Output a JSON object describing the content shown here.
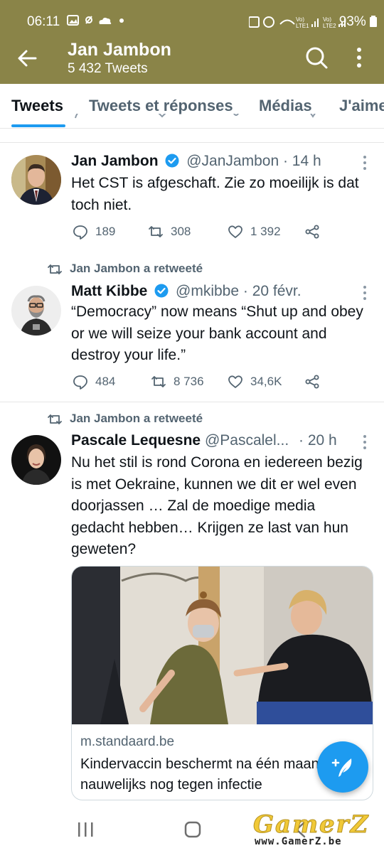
{
  "status_bar": {
    "time": "06:11",
    "right_text": "Vo) LTE1 .ıl Vo) LTE2 .ıl 93%",
    "battery": "93%"
  },
  "app_bar": {
    "title": "Jan Jambon",
    "subtitle": "5 432 Tweets"
  },
  "tabs": [
    {
      "label": "Tweets",
      "active": true
    },
    {
      "label": "Tweets et réponses",
      "active": false
    },
    {
      "label": "Médias",
      "active": false
    },
    {
      "label": "J'aime",
      "active": false
    }
  ],
  "tweets": [
    {
      "retweet_label": "",
      "name": "Jan Jambon",
      "verified": true,
      "handle": "@JanJambon",
      "time": "· 14 h",
      "text": "Het CST is afgeschaft. Zie zo moeilijk is dat toch niet.",
      "replies": "189",
      "retweets": "308",
      "likes": "1 392"
    },
    {
      "retweet_label": "Jan Jambon a retweeté",
      "name": "Matt Kibbe",
      "verified": true,
      "handle": "@mkibbe",
      "time": "· 20 févr.",
      "text": "“Democracy” now means “Shut up and obey or we will seize your bank account and destroy your life.”",
      "replies": "484",
      "retweets": "8 736",
      "likes": "34,6K"
    },
    {
      "retweet_label": "Jan Jambon a retweeté",
      "name": "Pascale Lequesne",
      "verified": false,
      "handle": "@Pascalel...",
      "time": "· 20 h",
      "text": "Nu het stil is rond Corona en iedereen bezig is met Oekraine, kunnen we dit er wel even doorjassen … Zal de moedige media gedacht hebben… Krijgen ze last van hun geweten?",
      "card": {
        "domain": "m.standaard.be",
        "title": "Kindervaccin beschermt na één maand nauwelijks nog tegen infectie"
      }
    }
  ],
  "watermark": {
    "brand": "GamerZ",
    "url": "www.GamerZ.be"
  },
  "colors": {
    "header": "#8a8448",
    "accent": "#1d9bf0",
    "muted": "#536471"
  }
}
